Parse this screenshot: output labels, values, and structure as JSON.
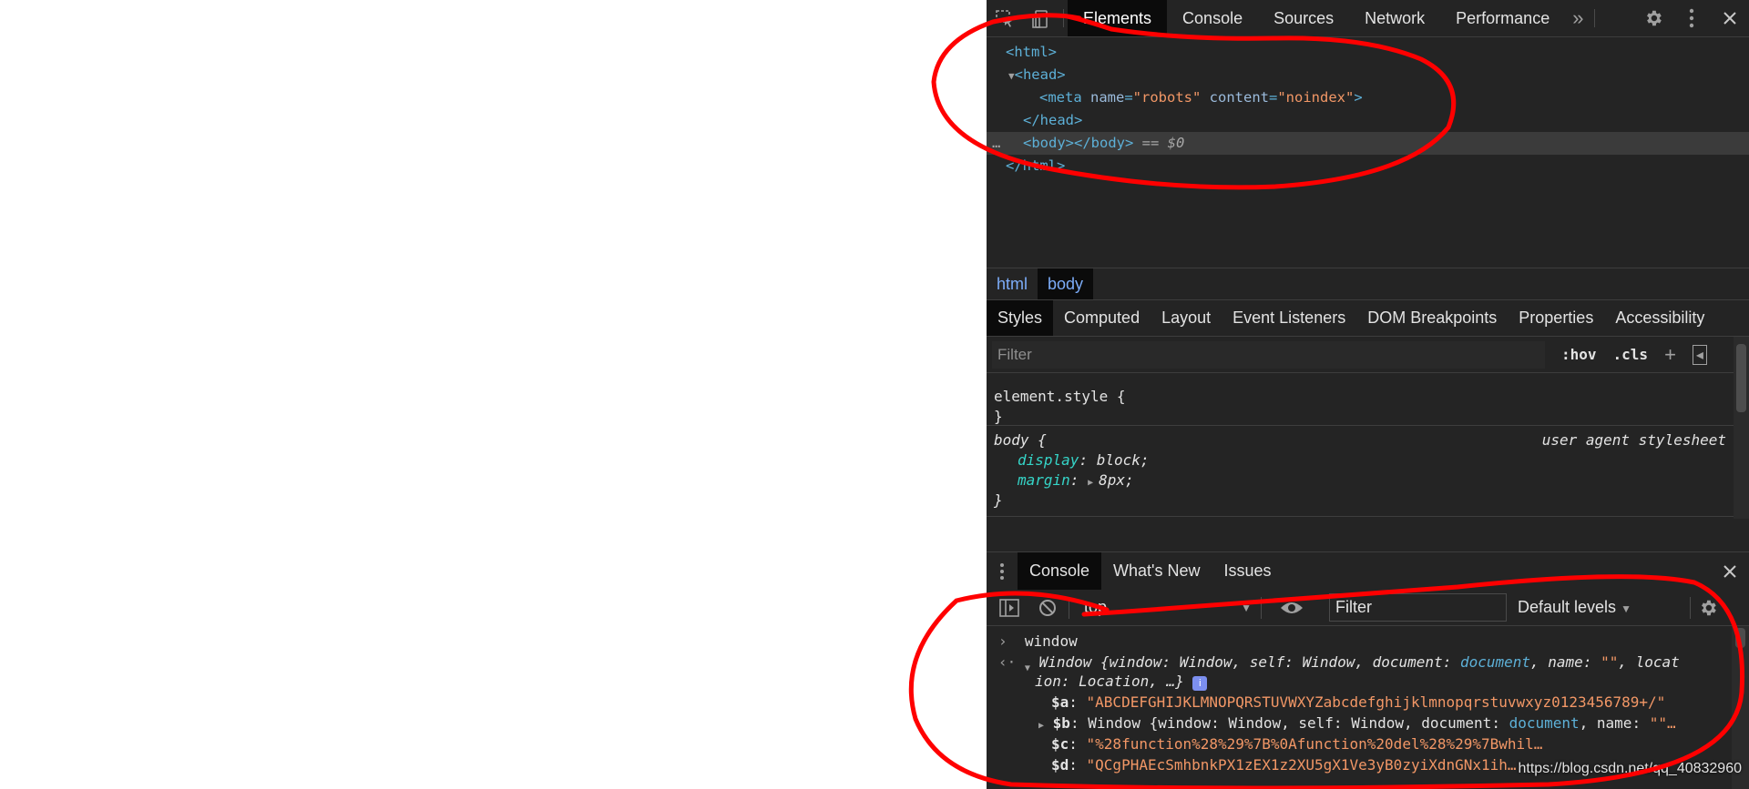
{
  "devtools": {
    "toolbar": {
      "icons": [
        "inspect-element-icon",
        "device-toggle-icon"
      ],
      "tabs": [
        "Elements",
        "Console",
        "Sources",
        "Network",
        "Performance"
      ],
      "overflow": "»",
      "right_icons": [
        "gear-icon",
        "kebab-menu-icon",
        "close-icon"
      ]
    },
    "dom": {
      "html_open": "<html>",
      "head_open": "<head>",
      "meta_tag_open": "<meta ",
      "meta_name_attr": "name",
      "meta_name_val": "\"robots\"",
      "meta_content_attr": "content",
      "meta_content_val": "\"noindex\"",
      "meta_close": ">",
      "head_close": "</head>",
      "body": "<body></body>",
      "selected_marker": "== $0",
      "ellipsis": "…",
      "html_close": "</html>"
    },
    "breadcrumbs": [
      "html",
      "body"
    ],
    "styles_tabs": [
      "Styles",
      "Computed",
      "Layout",
      "Event Listeners",
      "DOM Breakpoints",
      "Properties",
      "Accessibility"
    ],
    "styles_filter": {
      "placeholder": "Filter",
      "hov": ":hov",
      "cls": ".cls",
      "add": "+",
      "sidebar_toggle": "◂"
    },
    "styles": {
      "element_style_open": "element.style {",
      "close_brace": "}",
      "body_selector": "body {",
      "body_source": "user agent stylesheet",
      "display_prop": "display",
      "display_val": "block;",
      "margin_prop": "margin",
      "margin_val": "8px;"
    },
    "drawer": {
      "tabs": [
        "Console",
        "What's New",
        "Issues"
      ],
      "context": "top",
      "filter_placeholder": "Filter",
      "levels": "Default levels"
    },
    "console": {
      "input": "window",
      "result_prefix": "Window {window: Window, self: Window, document: ",
      "result_doc": "document",
      "result_mid": ", name: ",
      "result_name": "\"\"",
      "result_tail": ", locat",
      "result_line2": "ion: Location, …}",
      "info_badge": "i",
      "a_key": "$a",
      "a_val": "\"ABCDEFGHIJKLMNOPQRSTUVWXYZabcdefghijklmnopqrstuvwxyz0123456789+/\"",
      "b_key": "$b",
      "b_val_prefix": "Window {window: Window, self: Window, document: ",
      "b_doc": "document",
      "b_name": ", name: ",
      "b_tail": "\"\"…",
      "c_key": "$c",
      "c_val": "\"%28function%28%29%7B%0Afunction%20del%28%29%7Bwhil…",
      "d_key": "$d",
      "d_val": "\"QCgPHAEcSmhbnkPX1zEX1z2XU5gX1Ve3yB0zyiXdnGNx1ih…"
    },
    "watermark": "https://blog.csdn.net/qq_40832960"
  },
  "colors": {
    "panel_bg": "#242424",
    "active_tab_bg": "#0b0b0b",
    "tag": "#5db0d7",
    "attr_value": "#f29766",
    "css_property": "#35d4c7",
    "annotation_red": "#ff0000"
  }
}
